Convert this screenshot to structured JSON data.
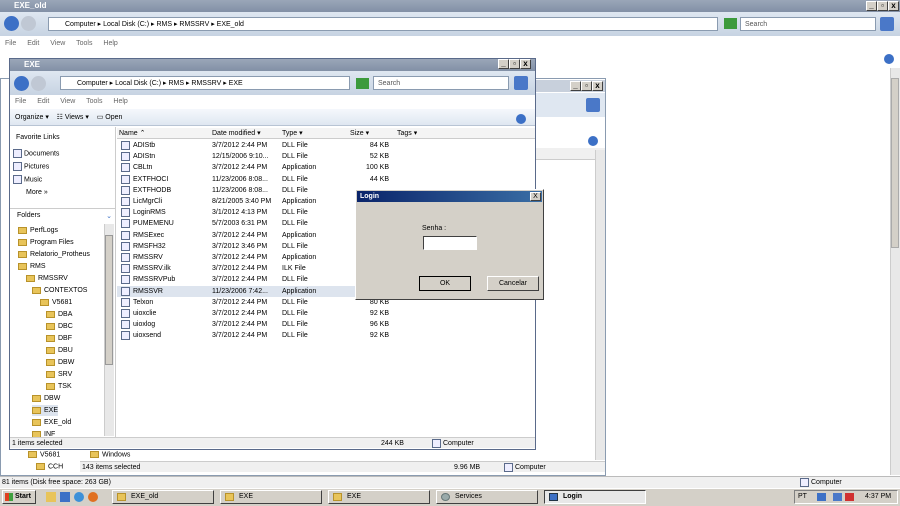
{
  "back_window": {
    "title": "EXE_old",
    "breadcrumb": [
      "Computer",
      "Local Disk (C:)",
      "RMS",
      "RMSSRV",
      "EXE_old"
    ],
    "search_placeholder": "Search",
    "menu": [
      "File",
      "Edit",
      "View",
      "Tools",
      "Help"
    ],
    "bottom_status": "81 items (Disk free space: 263 GB)",
    "bottom_status_location": "Computer"
  },
  "mid_window": {
    "tree_items": [
      "V5681",
      "CCH"
    ],
    "list_item": "Windows",
    "status_left": "143 items selected",
    "status_size": "9.96 MB",
    "status_location": "Computer"
  },
  "front_window": {
    "title": "EXE",
    "breadcrumb": [
      "Computer",
      "Local Disk (C:)",
      "RMS",
      "RMSSRV",
      "EXE"
    ],
    "search_placeholder": "Search",
    "menu": [
      "File",
      "Edit",
      "View",
      "Tools",
      "Help"
    ],
    "toolbar": {
      "organize": "Organize",
      "views": "Views",
      "open": "Open"
    },
    "favorite_links_header": "Favorite Links",
    "favorites": [
      "Documents",
      "Pictures",
      "Music"
    ],
    "more": "More »",
    "folders_header": "Folders",
    "tree": [
      "PerfLogs",
      "Program Files",
      "Relatorio_Protheus",
      "RMS",
      "RMSSRV",
      "CONTEXTOS",
      "V5681",
      "DBA",
      "DBC",
      "DBF",
      "DBU",
      "DBW",
      "SRV",
      "TSK",
      "DBW",
      "EXE",
      "EXE_old",
      "INF"
    ],
    "columns": [
      "Name",
      "Date modified",
      "Type",
      "Size",
      "Tags"
    ],
    "files": [
      {
        "name": "ADIStb",
        "date": "3/7/2012 2:44 PM",
        "type": "DLL File",
        "size": "84 KB"
      },
      {
        "name": "ADIStn",
        "date": "12/15/2006 9:10...",
        "type": "DLL File",
        "size": "52 KB"
      },
      {
        "name": "CBLtn",
        "date": "3/7/2012 2:44 PM",
        "type": "Application",
        "size": "100 KB"
      },
      {
        "name": "EXTFHOCI",
        "date": "11/23/2006 8:08...",
        "type": "DLL File",
        "size": "44 KB"
      },
      {
        "name": "EXTFHODB",
        "date": "11/23/2006 8:08...",
        "type": "DLL File",
        "size": ""
      },
      {
        "name": "LicMgrCli",
        "date": "8/21/2005 3:40 PM",
        "type": "Application",
        "size": ""
      },
      {
        "name": "LoginRMS",
        "date": "3/1/2012 4:13 PM",
        "type": "DLL File",
        "size": ""
      },
      {
        "name": "PUMEMENU",
        "date": "5/7/2003 6:31 PM",
        "type": "DLL File",
        "size": ""
      },
      {
        "name": "RMSExec",
        "date": "3/7/2012 2:44 PM",
        "type": "Application",
        "size": ""
      },
      {
        "name": "RMSFH32",
        "date": "3/7/2012 3:46 PM",
        "type": "DLL File",
        "size": ""
      },
      {
        "name": "RMSSRV",
        "date": "3/7/2012 2:44 PM",
        "type": "Application",
        "size": ""
      },
      {
        "name": "RMSSRV.ilk",
        "date": "3/7/2012 2:44 PM",
        "type": "ILK File",
        "size": ""
      },
      {
        "name": "RMSSRVPub",
        "date": "3/7/2012 2:44 PM",
        "type": "DLL File",
        "size": ""
      },
      {
        "name": "RMSSVR",
        "date": "11/23/2006 7:42...",
        "type": "Application",
        "size": ""
      },
      {
        "name": "Telxon",
        "date": "3/7/2012 2:44 PM",
        "type": "DLL File",
        "size": "80 KB"
      },
      {
        "name": "uioxclie",
        "date": "3/7/2012 2:44 PM",
        "type": "DLL File",
        "size": "92 KB"
      },
      {
        "name": "uioxlog",
        "date": "3/7/2012 2:44 PM",
        "type": "DLL File",
        "size": "96 KB"
      },
      {
        "name": "uioxsend",
        "date": "3/7/2012 2:44 PM",
        "type": "DLL File",
        "size": "92 KB"
      }
    ],
    "status_left": "1 items selected",
    "status_size": "244 KB",
    "status_location": "Computer"
  },
  "login_dialog": {
    "title": "Login",
    "close": "X",
    "password_label": "Senha :",
    "password_value": "",
    "ok": "OK",
    "cancel": "Cancelar"
  },
  "taskbar": {
    "start": "Start",
    "tasks": [
      "EXE_old",
      "EXE",
      "EXE",
      "Services",
      "Login"
    ],
    "lang": "PT",
    "clock": "4:37 PM"
  }
}
